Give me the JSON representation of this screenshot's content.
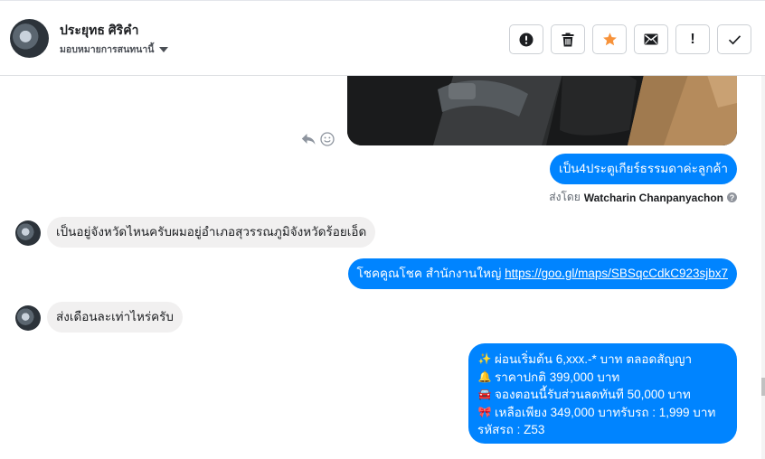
{
  "header": {
    "contact_name": "ประยุทธ ศิริคำ",
    "assign_label": "มอบหมายการสนทนานี้",
    "tools": [
      {
        "icon": "alert-circle-icon"
      },
      {
        "icon": "trash-icon"
      },
      {
        "icon": "star-icon"
      },
      {
        "icon": "envelope-icon"
      },
      {
        "icon": "exclamation-icon",
        "glyph": "!"
      },
      {
        "icon": "checkmark-icon"
      }
    ]
  },
  "messages": {
    "out_gear": "เป็น4ประตูเกียร์ธรรมดาค่ะลูกค้า",
    "sent_by_prefix": "ส่งโดย",
    "sent_by_name": "Watcharin Chanpanyachon",
    "in_province": "เป็นอยู่จังหวัดไหนครับผมอยู่อำเภอสุวรรณภูมิจังหวัดร้อยเอ็ด",
    "out_branch_text": "โชคคูณโชค สำนักงานใหญ่ ",
    "out_branch_link": "https://goo.gl/maps/SBSqcCdkC923sjbx7",
    "in_monthly": "ส่งเดือนละเท่าไหร่ครับ",
    "promo_lines": [
      {
        "emoji": "✨",
        "text": "ผ่อนเริ่มต้น 6,xxx.-* บาท ตลอดสัญญา"
      },
      {
        "emoji": "🔔",
        "text": "ราคาปกติ 399,000 บาท"
      },
      {
        "emoji": "🚘",
        "text": "จองตอนนี้รับส่วนลดทันที 50,000 บาท"
      },
      {
        "emoji": "🎀",
        "text": "เหลือเพียง 349,000 บาทรับรถ : 1,999 บาท"
      },
      {
        "emoji": "",
        "text": "รหัสรถ : Z53"
      }
    ]
  },
  "colors": {
    "accent_blue": "#0084ff",
    "star_orange": "#f7923a",
    "incoming_bg": "#f1f0f0"
  }
}
